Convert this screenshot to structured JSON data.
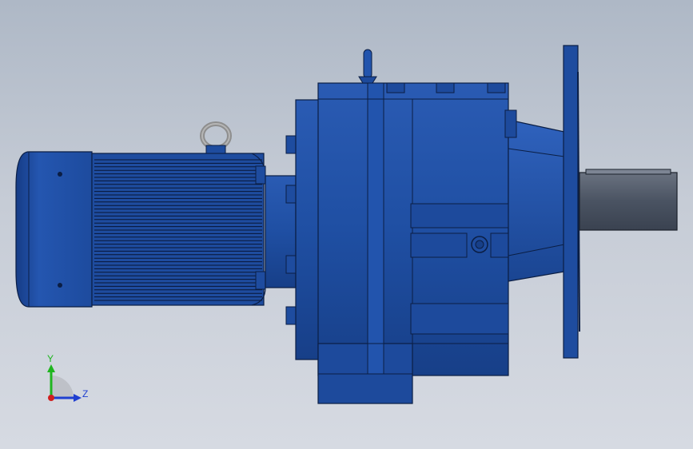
{
  "viewport": {
    "background_top": "#aeb8c6",
    "background_bottom": "#d6dae2",
    "model_color": "#1f4fa3",
    "model_edge": "#000000",
    "shaft_color": "#4f5866"
  },
  "triad": {
    "y_label": "Y",
    "z_label": "Z",
    "y_color": "#1fb51f",
    "z_color": "#1f3fd0",
    "x_color": "#d01f1f",
    "icon": "coordinate-triad-icon"
  }
}
